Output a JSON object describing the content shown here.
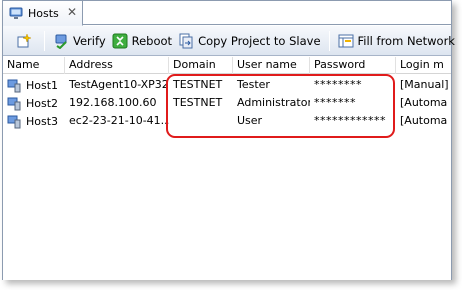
{
  "tab": {
    "title": "Hosts",
    "close": "✕"
  },
  "toolbar": {
    "verify_label": "Verify",
    "reboot_label": "Reboot",
    "copy_label": "Copy Project to Slave",
    "fill_label": "Fill from Network"
  },
  "columns": [
    "Name",
    "Address",
    "Domain",
    "User name",
    "Password",
    "Login m"
  ],
  "rows": [
    {
      "name": "Host1",
      "address": "TestAgent10-XP32",
      "domain": "TESTNET",
      "user": "Tester",
      "password": "********",
      "login": "[Manual]"
    },
    {
      "name": "Host2",
      "address": "192.168.100.60",
      "domain": "TESTNET",
      "user": "Administrator",
      "password": "*******",
      "login": "[Automa"
    },
    {
      "name": "Host3",
      "address": "ec2-23-21-10-41....",
      "domain": "",
      "user": "User",
      "password": "************",
      "login": "[Automa"
    }
  ],
  "colors": {
    "highlight": "#e01b1b",
    "accent": "#3a6fc4"
  }
}
